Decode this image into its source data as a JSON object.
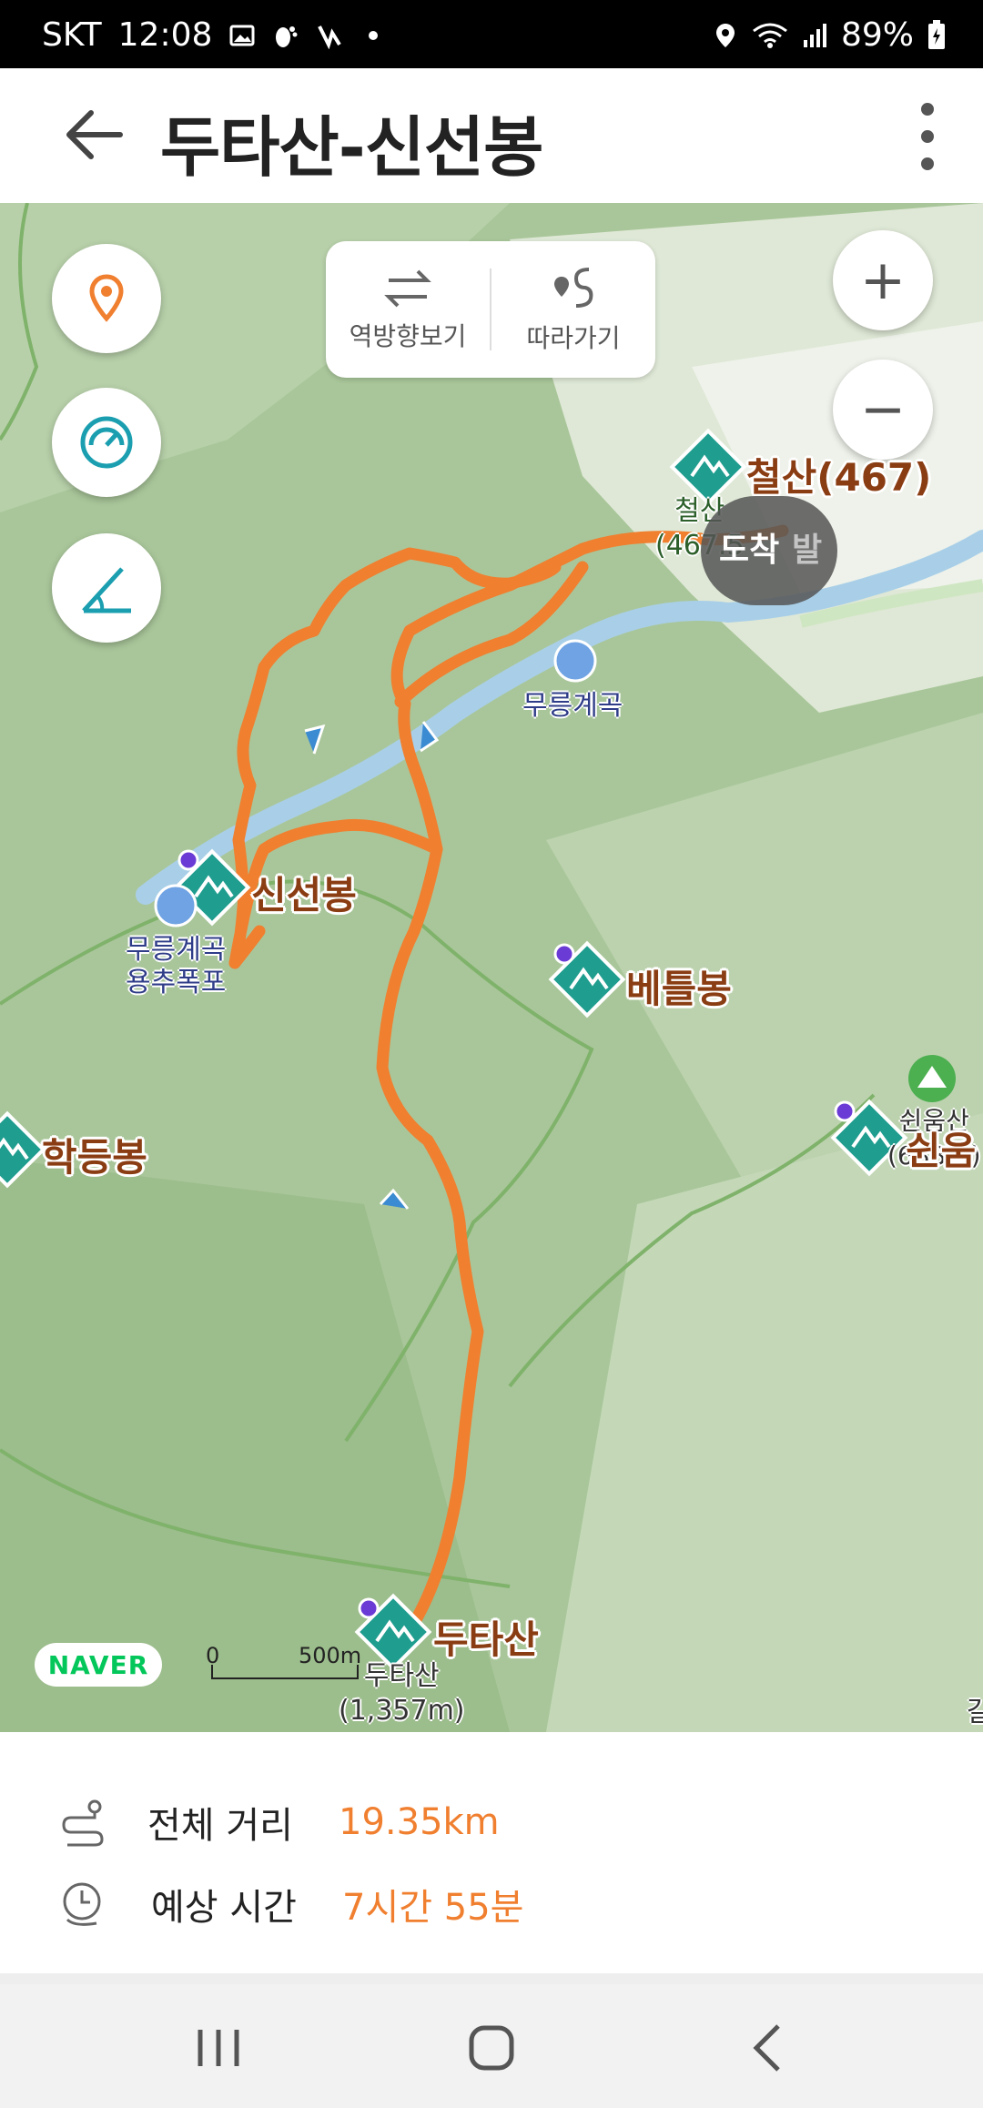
{
  "status_bar": {
    "carrier": "SKT",
    "time": "12:08",
    "battery": "89%",
    "icons": [
      "image-icon",
      "footprint-icon",
      "signal-app-icon",
      "dot-icon",
      "location-icon",
      "wifi-icon",
      "cell-signal-icon",
      "battery-icon"
    ]
  },
  "header": {
    "title": "두타산-신선봉",
    "back_icon": "arrow-left-icon",
    "menu_icon": "more-vertical-icon"
  },
  "map": {
    "controls": {
      "reverse_label": "역방향보기",
      "follow_label": "따라가기",
      "zoom_in": "+",
      "zoom_out": "−"
    },
    "side_buttons": [
      "location-pin-icon",
      "speedometer-icon",
      "slope-icon"
    ],
    "arrival_label": "도착",
    "arrival_underlabel": "발",
    "peaks": {
      "cheolsan": "철산(467)",
      "cheolsan_sub_1": "철산",
      "cheolsan_sub_2": "(467.5",
      "sinseonbong": "신선봉",
      "betelbong": "베틀봉",
      "hakdeungbong": "학등봉",
      "swiumsan": "쉰움",
      "swiumsan_sub_1": "쉰움산",
      "swiumsan_sub_2": "(688m)",
      "dutasan": "두타산",
      "dutasan_sub_1": "두타산",
      "dutasan_sub_2": "(1,357m)"
    },
    "places": {
      "mureung_valley": "무릉계곡",
      "yongchu_1": "무릉계곡",
      "yongchu_2": "용추폭포"
    },
    "naver_logo": "NAVER",
    "scale": {
      "zero": "0",
      "dist": "500m"
    },
    "edge_char": "갈",
    "colors": {
      "route": "#f07f2f",
      "water": "#a9cfe8",
      "terrain": "#a7c497",
      "peak": "#1f9d8f"
    }
  },
  "summary": {
    "distance_label": "전체 거리",
    "distance_value": "19.35km",
    "time_label": "예상 시간",
    "time_value": "7시간 55분"
  },
  "nav_bar": {
    "icons": [
      "recent-apps-icon",
      "home-icon",
      "back-icon"
    ]
  }
}
